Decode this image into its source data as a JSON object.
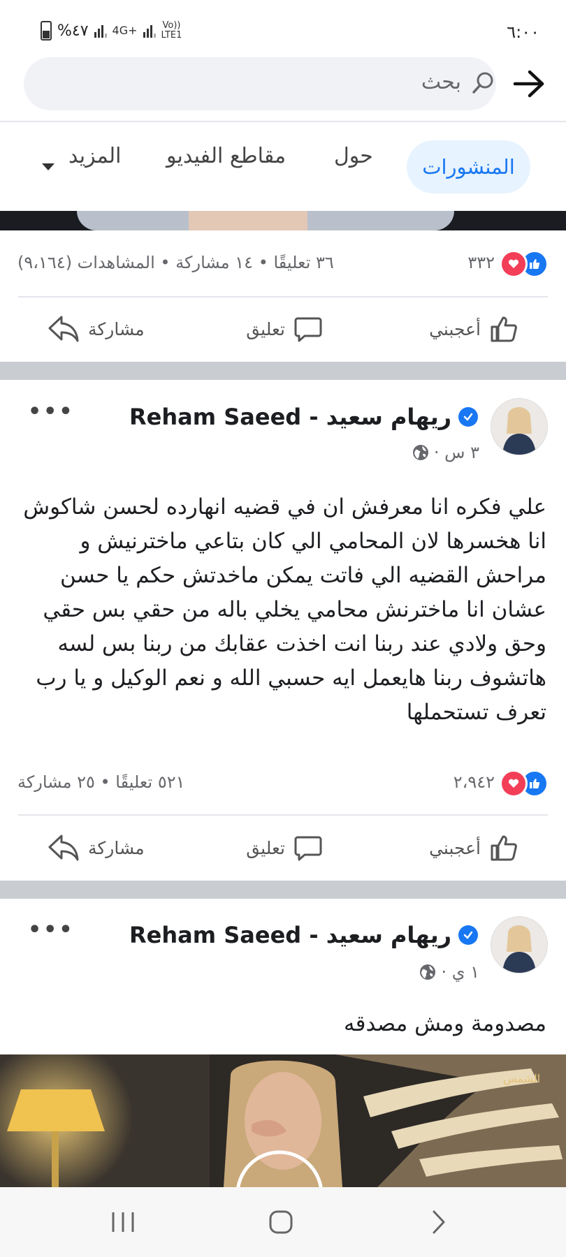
{
  "status_bar": {
    "time": "٦:٠٠",
    "battery": "%٤٧",
    "network1": "4G+",
    "network2": "Vo))\nLTE1"
  },
  "header": {
    "search_placeholder": "بحث"
  },
  "tabs": [
    {
      "label": "المنشورات",
      "active": true
    },
    {
      "label": "حول"
    },
    {
      "label": "مقاطع الفيديو"
    },
    {
      "label": "المزيد"
    }
  ],
  "colors": {
    "accent": "#1877f2",
    "love": "#f33e58",
    "separator": "#c9ccd1"
  },
  "posts": [
    {
      "reactions_count": "٣٣٢",
      "stats": "٣٦ تعليقًا • ١٤ مشاركة • المشاهدات (٩،١٦٤)",
      "actions": {
        "like": "أعجبني",
        "comment": "تعليق",
        "share": "مشاركة"
      }
    },
    {
      "author": "Reham Saeed - ريهام سعيد",
      "time": "٣ س ·",
      "text_lines": [
        "علي فكره انا معرفش ان في قضيه انهارده لحسن شاكوش",
        "انا هخسرها لان المحامي  الي كان بتاعي ماخترنيش و",
        "مراحش القضيه الي فاتت يمكن ماخدتش حكم يا حسن",
        "عشان  انا ماخترنش محامي يخلي باله من حقي بس حقي",
        "وحق ولادي عند ربنا انت اخذت عقابك من ربنا بس لسه",
        "هاتشوف ربنا هايعمل ايه حسبي الله و نعم الوكيل و يا رب",
        "تعرف تستحملها"
      ],
      "reactions_count": "٢،٩٤٢",
      "stats": "٥٢١ تعليقًا • ٢٥ مشاركة",
      "actions": {
        "like": "أعجبني",
        "comment": "تعليق",
        "share": "مشاركة"
      }
    },
    {
      "author": "Reham Saeed - ريهام سعيد",
      "time": "١ ي ·",
      "text": "مصدومة ومش مصدقه"
    }
  ]
}
